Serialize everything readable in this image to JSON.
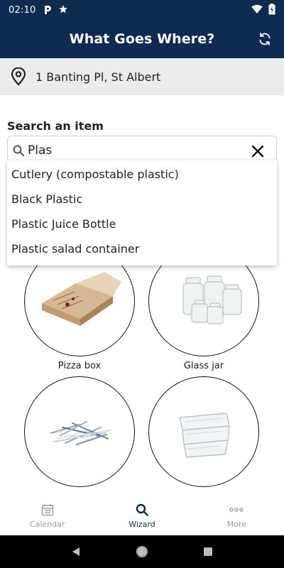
{
  "status_bar": {
    "time": "02:10",
    "notification_icons": [
      "parking-app-icon",
      "star-icon"
    ],
    "system_icons": [
      "wifi-icon",
      "battery-icon"
    ]
  },
  "header": {
    "title": "What Goes Where?",
    "action_icon": "refresh-icon"
  },
  "address": {
    "icon": "location-pin-icon",
    "text": "1 Banting Pl, St Albert"
  },
  "search": {
    "label": "Search an item",
    "value": "Plas",
    "clear_icon": "close-icon"
  },
  "suggestions": [
    "Cutlery (compostable plastic)",
    "Black Plastic",
    "Plastic Juice Bottle",
    "Plastic salad container"
  ],
  "items": [
    {
      "label": "Pizza box",
      "image": "pizza-box-image"
    },
    {
      "label": "Glass jar",
      "image": "glass-jars-image"
    },
    {
      "label": "",
      "image": "shredded-paper-image"
    },
    {
      "label": "",
      "image": "plastic-clamshell-image"
    }
  ],
  "bottom_nav": [
    {
      "label": "Calendar",
      "icon": "calendar-icon",
      "active": false
    },
    {
      "label": "Wizard",
      "icon": "search-icon",
      "active": true
    },
    {
      "label": "More",
      "icon": "more-icon",
      "active": false
    }
  ],
  "colors": {
    "primary": "#0f2b52",
    "address_bg": "#ebebeb",
    "inactive": "#9a9a9a"
  }
}
